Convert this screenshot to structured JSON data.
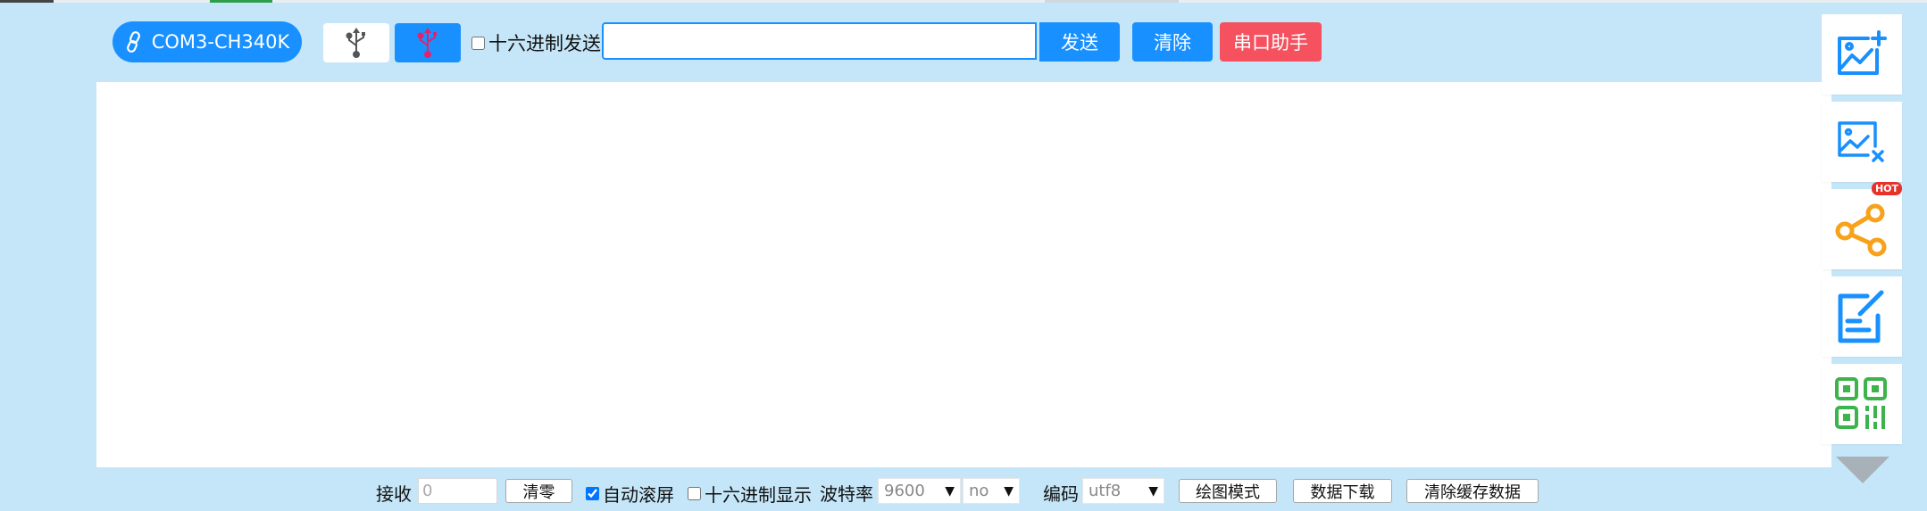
{
  "toolbar": {
    "port_label": "COM3-CH340K",
    "hex_send_label": "十六进制发送",
    "hex_send_checked": false,
    "send_input_value": "",
    "send_label": "发送",
    "clear_label": "清除",
    "assistant_label": "串口助手",
    "usb_icon_colors": {
      "disconnected": "#555555",
      "connected": "#e0236b"
    }
  },
  "output": {
    "text": ""
  },
  "side_panel": {
    "buttons": [
      {
        "name": "add-chart-icon",
        "color": "#1890ff"
      },
      {
        "name": "remove-chart-icon",
        "color": "#1890ff"
      },
      {
        "name": "share-icon",
        "color": "#f7a21b",
        "badge": "HOT"
      },
      {
        "name": "edit-note-icon",
        "color": "#1890ff"
      },
      {
        "name": "qrcode-icon",
        "color": "#3cb44b"
      }
    ]
  },
  "statusbar": {
    "recv_label": "接收",
    "recv_value": "0",
    "reset_label": "清零",
    "auto_scroll_label": "自动滚屏",
    "auto_scroll_checked": true,
    "hex_display_label": "十六进制显示",
    "hex_display_checked": false,
    "baud_label": "波特率",
    "baud_value": "9600",
    "parity_value": "no",
    "encoding_label": "编码",
    "encoding_value": "utf8",
    "plot_mode_label": "绘图模式",
    "download_label": "数据下载",
    "clear_cache_label": "清除缓存数据"
  },
  "colors": {
    "background": "#c5e6f8",
    "primary": "#1890ff",
    "danger": "#f5515f"
  }
}
